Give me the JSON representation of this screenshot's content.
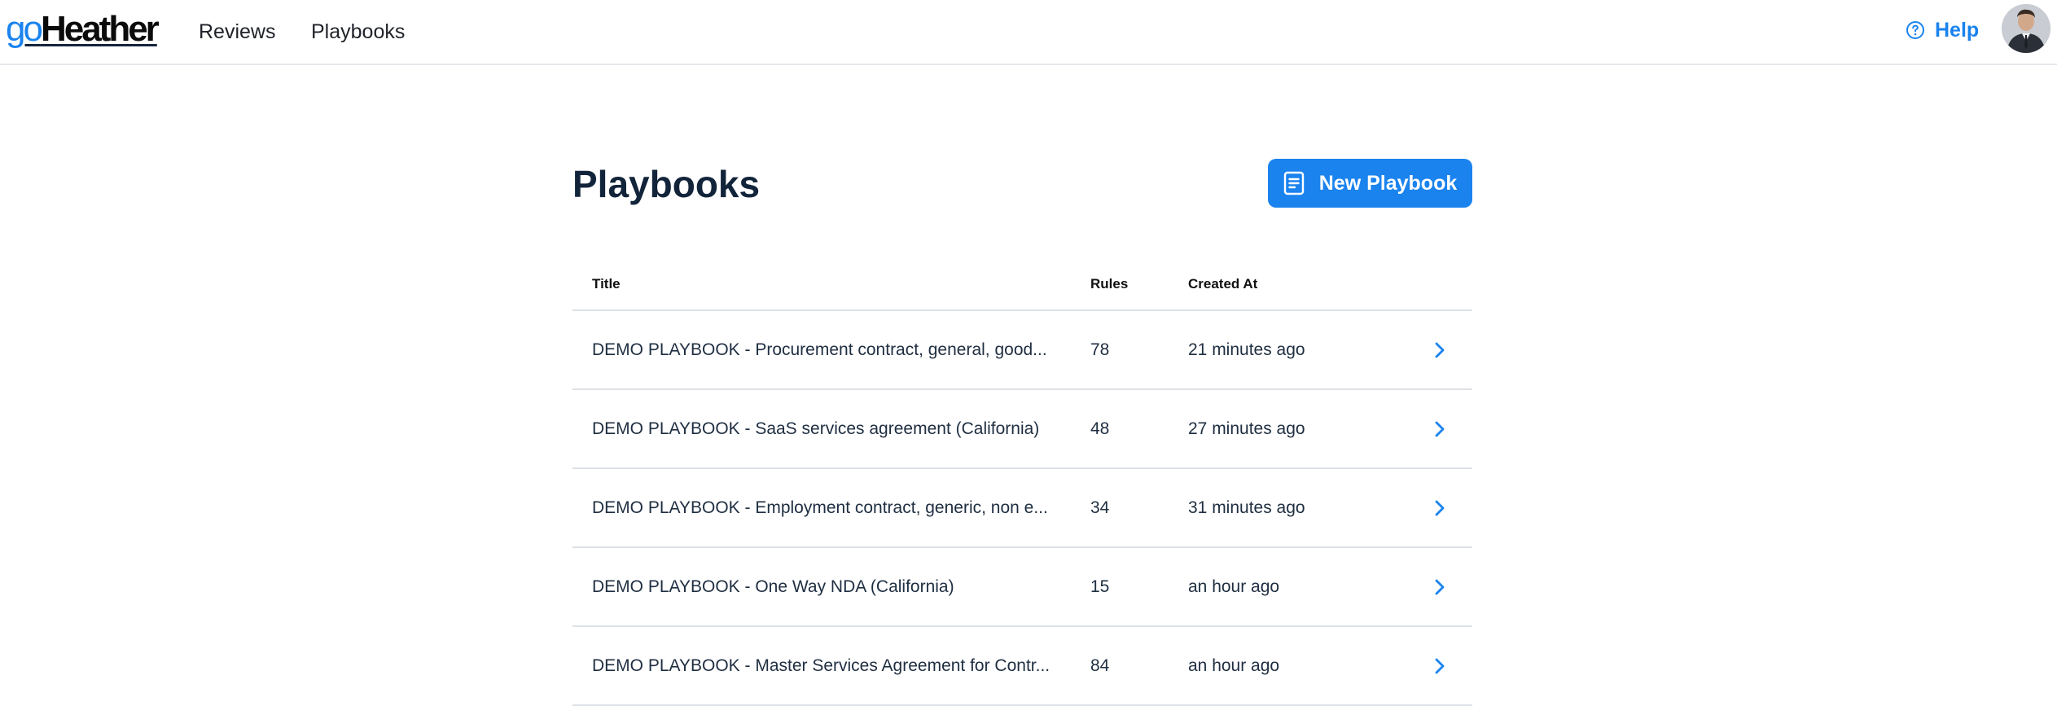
{
  "nav": {
    "logo_prefix": "go",
    "logo_main": "Heather",
    "links": [
      "Reviews",
      "Playbooks"
    ],
    "help_label": "Help"
  },
  "page": {
    "title": "Playbooks",
    "new_button_label": "New Playbook"
  },
  "table": {
    "headers": [
      "Title",
      "Rules",
      "Created At"
    ],
    "rows": [
      {
        "title": "DEMO PLAYBOOK - Procurement contract, general, good...",
        "rules": "78",
        "created": "21 minutes ago"
      },
      {
        "title": "DEMO PLAYBOOK - SaaS services agreement (California)",
        "rules": "48",
        "created": "27 minutes ago"
      },
      {
        "title": "DEMO PLAYBOOK - Employment contract, generic, non e...",
        "rules": "34",
        "created": "31 minutes ago"
      },
      {
        "title": "DEMO PLAYBOOK - One Way NDA (California)",
        "rules": "15",
        "created": "an hour ago"
      },
      {
        "title": "DEMO PLAYBOOK - Master Services Agreement for Contr...",
        "rules": "84",
        "created": "an hour ago"
      }
    ]
  },
  "icons": {
    "help": "help-circle-icon",
    "new_button": "document-icon",
    "row_action": "chevron-right-icon"
  },
  "colors": {
    "accent": "#1a83ee",
    "title_text": "#12243a",
    "divider": "#dde1e7"
  }
}
